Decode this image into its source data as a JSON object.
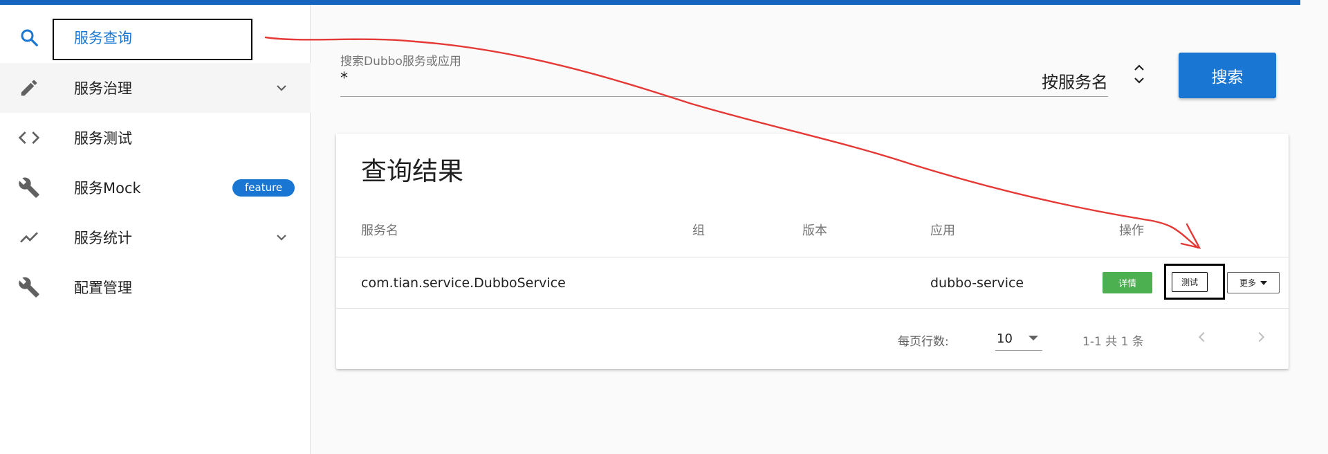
{
  "sidebar": {
    "items": [
      {
        "label": "服务查询",
        "icon": "search-icon"
      },
      {
        "label": "服务治理",
        "icon": "pencil-icon"
      },
      {
        "label": "服务测试",
        "icon": "code-icon"
      },
      {
        "label": "服务Mock",
        "icon": "wrench-icon",
        "badge": "feature"
      },
      {
        "label": "服务统计",
        "icon": "trending-icon"
      },
      {
        "label": "配置管理",
        "icon": "wrench-icon"
      }
    ]
  },
  "search": {
    "label": "搜索Dubbo服务或应用",
    "value": "*",
    "mode": "按服务名",
    "button": "搜索"
  },
  "results": {
    "title": "查询结果",
    "columns": [
      "服务名",
      "组",
      "版本",
      "应用",
      "操作"
    ],
    "rows": [
      {
        "service": "com.tian.service.DubboService",
        "group": "",
        "version": "",
        "application": "dubbo-service"
      }
    ],
    "actions": {
      "detail": "详情",
      "test": "测试",
      "more": "更多"
    },
    "pagination": {
      "rows_per_page_label": "每页行数:",
      "rows_per_page": "10",
      "range": "1-1 共 1 条"
    }
  },
  "colors": {
    "primary": "#1976d2",
    "success": "#4caf50",
    "annotation": "#e53935"
  }
}
